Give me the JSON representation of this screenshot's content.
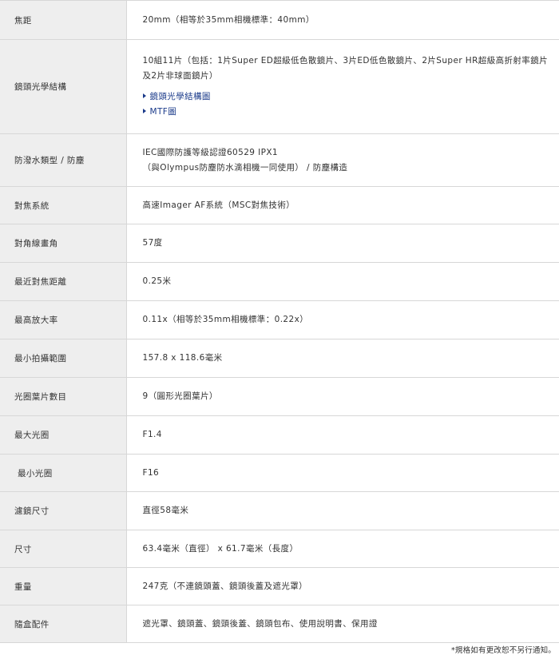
{
  "specs": [
    {
      "label": "焦距",
      "value": "20mm（相等於35mm相機標準：40mm）"
    },
    {
      "label": "鏡頭光學結構",
      "value": "10組11片（包括：1片Super ED超級低色散鏡片、3片ED低色散鏡片、2片Super HR超級高折射率鏡片及2片非球面鏡片）",
      "links": [
        "鏡頭光學結構圖",
        "MTF圖"
      ]
    },
    {
      "label": "防潑水類型 / 防塵",
      "value": "IEC國際防護等級認證60529 IPX1",
      "value2": "（與Olympus防塵防水滴相機一同使用） / 防塵構造"
    },
    {
      "label": "對焦系統",
      "value": "高速Imager AF系統（MSC對焦技術）"
    },
    {
      "label": "對角線畫角",
      "value": "57度"
    },
    {
      "label": "最近對焦距離",
      "value": "0.25米"
    },
    {
      "label": "最高放大率",
      "value": "0.11x（相等於35mm相機標準：0.22x）"
    },
    {
      "label": "最小拍攝範圍",
      "value": "157.8 x 118.6毫米"
    },
    {
      "label": "光圈葉片數目",
      "value": "9（圓形光圈葉片）"
    },
    {
      "label": "最大光圈",
      "value": "F1.4"
    },
    {
      "label": "最小光圈",
      "value": "F16"
    },
    {
      "label": "濾鏡尺寸",
      "value": "直徑58毫米"
    },
    {
      "label": "尺寸",
      "value": "63.4毫米（直徑） x 61.7毫米（長度）"
    },
    {
      "label": "重量",
      "value": "247克（不連鏡頭蓋、鏡頭後蓋及遮光罩）"
    },
    {
      "label": "隨盒配件",
      "value": "遮光罩、鏡頭蓋、鏡頭後蓋、鏡頭包布、使用說明書、保用證"
    }
  ],
  "footnote": "*規格如有更改恕不另行通知。"
}
